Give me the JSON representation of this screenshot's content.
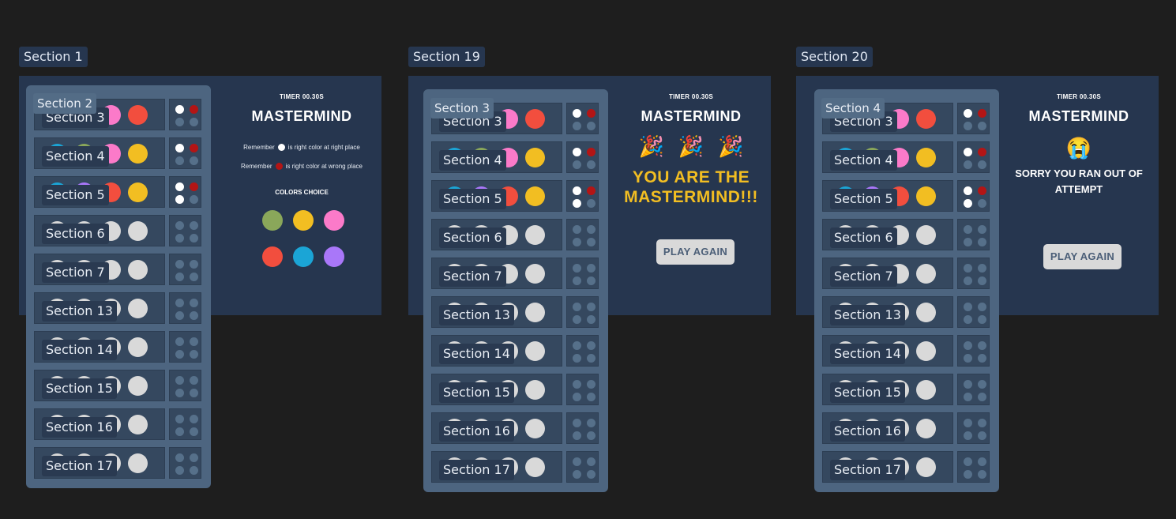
{
  "colors": {
    "bg": "#1e1e1e",
    "frame": "#26364f",
    "board": "#4d6580",
    "green": "#8aa75a",
    "yellow": "#f2be22",
    "pink": "#fb7ac9",
    "red": "#f24e3e",
    "blue": "#1ba5d6",
    "purple": "#a977f9",
    "hint_white": "#ffffff",
    "hint_red": "#b31515",
    "win_text": "#f2be22"
  },
  "frames": [
    {
      "label": "Section 1",
      "board_label": "Section 2",
      "timer": "TIMER 00.30S",
      "title": "MASTERMIND",
      "remember_1_a": "Remember",
      "remember_1_b": "is right color at right place",
      "remember_2_a": "Remember",
      "remember_2_b": "is right color at wrong place",
      "colors_heading": "COLORS CHOICE"
    },
    {
      "label": "Section 19",
      "board_label": "Section 3",
      "timer": "TIMER 00.30S",
      "title": "MASTERMIND",
      "emoji": [
        "🎉",
        "🎉",
        "🎉"
      ],
      "win_line1": "YOU ARE THE",
      "win_line2": "MASTERMIND!!!",
      "button": "PLAY AGAIN"
    },
    {
      "label": "Section 20",
      "board_label": "Section 4",
      "timer": "TIMER 00.30S",
      "title": "MASTERMIND",
      "emoji": "😭",
      "lose_line1": "SORRY YOU RAN OUT OF",
      "lose_line2": "ATTEMPT",
      "button": "PLAY AGAIN"
    }
  ],
  "rows": [
    {
      "label": "Section 3",
      "pegs": [
        "green",
        "red",
        "pink",
        "red"
      ],
      "hints": [
        "hint_white",
        "hint_red",
        "empty",
        "empty"
      ]
    },
    {
      "label": "Section 4",
      "pegs": [
        "blue",
        "green",
        "pink",
        "yellow"
      ],
      "hints": [
        "hint_white",
        "hint_red",
        "empty",
        "empty"
      ]
    },
    {
      "label": "Section 5",
      "pegs": [
        "blue",
        "purple",
        "red",
        "yellow"
      ],
      "hints": [
        "hint_white",
        "hint_red",
        "hint_white",
        "empty"
      ]
    },
    {
      "label": "Section 6",
      "pegs": [
        "empty",
        "empty",
        "empty",
        "empty"
      ],
      "hints": [
        "empty",
        "empty",
        "empty",
        "empty"
      ]
    },
    {
      "label": "Section 7",
      "pegs": [
        "empty",
        "empty",
        "empty",
        "empty"
      ],
      "hints": [
        "empty",
        "empty",
        "empty",
        "empty"
      ]
    },
    {
      "label": "Section 13",
      "pegs": [
        "empty",
        "empty",
        "empty",
        "empty"
      ],
      "hints": [
        "empty",
        "empty",
        "empty",
        "empty"
      ]
    },
    {
      "label": "Section 14",
      "pegs": [
        "empty",
        "empty",
        "empty",
        "empty"
      ],
      "hints": [
        "empty",
        "empty",
        "empty",
        "empty"
      ]
    },
    {
      "label": "Section 15",
      "pegs": [
        "empty",
        "empty",
        "empty",
        "empty"
      ],
      "hints": [
        "empty",
        "empty",
        "empty",
        "empty"
      ]
    },
    {
      "label": "Section 16",
      "pegs": [
        "empty",
        "empty",
        "empty",
        "empty"
      ],
      "hints": [
        "empty",
        "empty",
        "empty",
        "empty"
      ]
    },
    {
      "label": "Section 17",
      "pegs": [
        "empty",
        "empty",
        "empty",
        "empty"
      ],
      "hints": [
        "empty",
        "empty",
        "empty",
        "empty"
      ]
    }
  ],
  "color_choices": [
    "green",
    "yellow",
    "pink",
    "red",
    "blue",
    "purple"
  ]
}
